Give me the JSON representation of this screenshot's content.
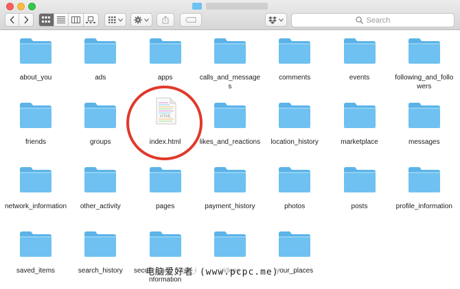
{
  "window": {
    "title_icon": "folder-icon"
  },
  "toolbar": {
    "back_icon": "chevron-left-icon",
    "forward_icon": "chevron-right-icon",
    "view_modes": [
      "icon-view",
      "list-view",
      "column-view",
      "gallery-view"
    ],
    "active_view": "icon-view"
  },
  "search": {
    "placeholder": "Search"
  },
  "files": [
    {
      "name": "about_you",
      "type": "folder"
    },
    {
      "name": "ads",
      "type": "folder"
    },
    {
      "name": "apps",
      "type": "folder"
    },
    {
      "name": "calls_and_messages",
      "type": "folder"
    },
    {
      "name": "comments",
      "type": "folder"
    },
    {
      "name": "events",
      "type": "folder"
    },
    {
      "name": "following_and_followers",
      "type": "folder"
    },
    {
      "name": "friends",
      "type": "folder"
    },
    {
      "name": "groups",
      "type": "folder"
    },
    {
      "name": "index.html",
      "type": "html",
      "doc_label": "HTML"
    },
    {
      "name": "likes_and_reactions",
      "type": "folder"
    },
    {
      "name": "location_history",
      "type": "folder"
    },
    {
      "name": "marketplace",
      "type": "folder"
    },
    {
      "name": "messages",
      "type": "folder"
    },
    {
      "name": "network_information",
      "type": "folder"
    },
    {
      "name": "other_activity",
      "type": "folder"
    },
    {
      "name": "pages",
      "type": "folder"
    },
    {
      "name": "payment_history",
      "type": "folder"
    },
    {
      "name": "photos",
      "type": "folder"
    },
    {
      "name": "posts",
      "type": "folder"
    },
    {
      "name": "profile_information",
      "type": "folder"
    },
    {
      "name": "saved_items",
      "type": "folder"
    },
    {
      "name": "search_history",
      "type": "folder"
    },
    {
      "name": "security_and_login_information",
      "type": "folder"
    },
    {
      "name": "videos",
      "type": "folder"
    },
    {
      "name": "your_places",
      "type": "folder"
    }
  ],
  "watermark": "电脑爱好者 (www.pcpc.me)",
  "colors": {
    "folder": "#6ec1f0",
    "folder_tab": "#5bb3e8",
    "highlight_circle": "#e0392b"
  }
}
